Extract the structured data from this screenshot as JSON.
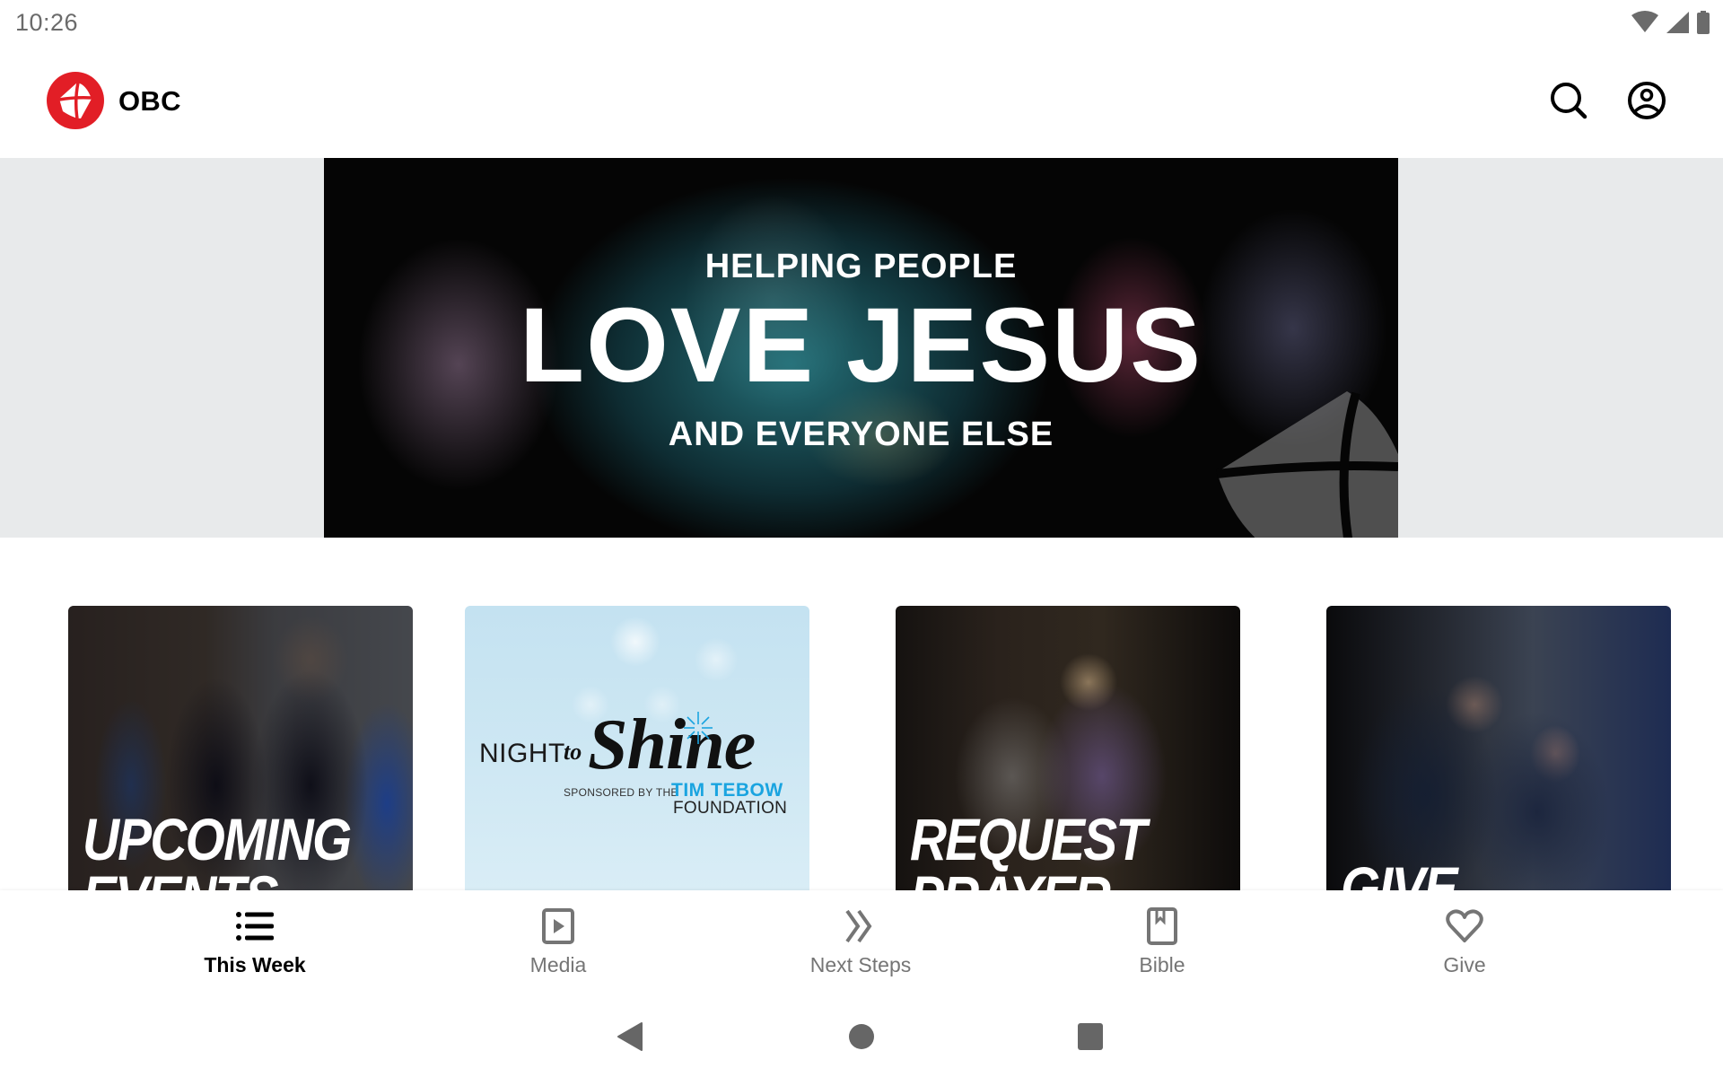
{
  "status_bar": {
    "time": "10:26",
    "icons": [
      "wifi-icon",
      "cell-signal-icon",
      "battery-icon"
    ],
    "icon_color": "#6b6b6b"
  },
  "app_bar": {
    "title": "OBC",
    "logo_color": "#e21e26",
    "actions": [
      {
        "name": "search",
        "icon": "search-icon"
      },
      {
        "name": "account",
        "icon": "account-circle-icon"
      }
    ]
  },
  "hero": {
    "line1": "HELPING PEOPLE",
    "line2": "LOVE JESUS",
    "line3": "AND EVERYONE ELSE"
  },
  "cards": [
    {
      "caption_line1": "UPCOMING",
      "caption_line2": "EVENTS"
    },
    {
      "logo_night": "NIGHT",
      "logo_to": "to",
      "logo_shine": "Shine",
      "sponsored": "SPONSORED BY THE",
      "foundation_name": "TIM TEBOW",
      "foundation_word": "FOUNDATION",
      "accent_color": "#1aa4e0"
    },
    {
      "caption_line1": "REQUEST",
      "caption_line2": "PRAYER"
    },
    {
      "caption_line1": "GIVE",
      "caption_line2": ""
    }
  ],
  "bottom_nav": {
    "active_color": "#000000",
    "inactive_color": "#757575",
    "items": [
      {
        "label": "This Week",
        "icon": "list-icon",
        "active": true
      },
      {
        "label": "Media",
        "icon": "play-square-icon",
        "active": false
      },
      {
        "label": "Next Steps",
        "icon": "double-chevron-right-icon",
        "active": false
      },
      {
        "label": "Bible",
        "icon": "book-bookmark-icon",
        "active": false
      },
      {
        "label": "Give",
        "icon": "heart-icon",
        "active": false
      }
    ]
  },
  "system_nav": {
    "buttons": [
      "back",
      "home",
      "recents"
    ]
  }
}
